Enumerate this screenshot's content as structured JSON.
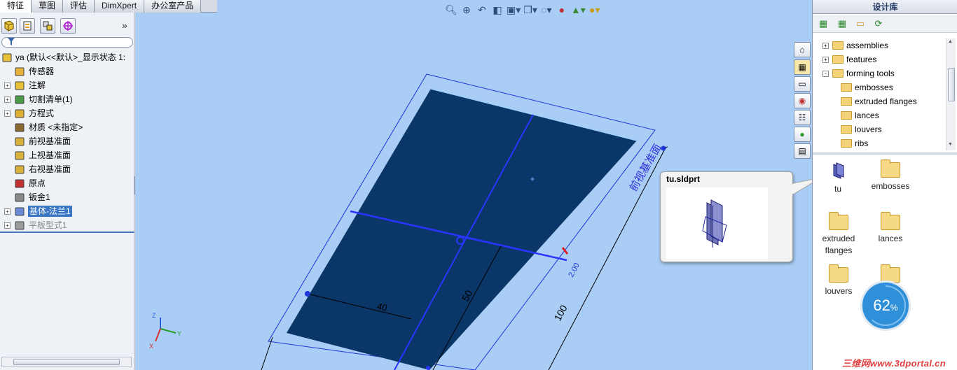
{
  "tabs": [
    "特征",
    "草图",
    "评估",
    "DimXpert",
    "办公室产品"
  ],
  "feature_manager": {
    "collapse_glyph": "»",
    "toolbar_icons": [
      "feature-manager-icon",
      "property-manager-icon",
      "configuration-manager-icon",
      "dimxpert-manager-icon"
    ],
    "tree": [
      {
        "label": "ya  (默认<<默认>_显示状态 1:",
        "icon": "part-icon",
        "expander": false,
        "root": true
      },
      {
        "label": "传感器",
        "icon": "sensor-icon",
        "expander": false
      },
      {
        "label": "注解",
        "icon": "annotation-icon",
        "expander": true
      },
      {
        "label": "切割清单(1)",
        "icon": "cutlist-icon",
        "expander": true
      },
      {
        "label": "方程式",
        "icon": "equation-icon",
        "expander": true
      },
      {
        "label": "材质 <未指定>",
        "icon": "material-icon",
        "expander": false
      },
      {
        "label": "前视基准面",
        "icon": "plane-icon",
        "expander": false
      },
      {
        "label": "上视基准面",
        "icon": "plane-icon",
        "expander": false
      },
      {
        "label": "右视基准面",
        "icon": "plane-icon",
        "expander": false
      },
      {
        "label": "原点",
        "icon": "origin-icon",
        "expander": false
      },
      {
        "label": "钣金1",
        "icon": "sheetmetal-icon",
        "expander": false
      },
      {
        "label": "基体-法兰1",
        "icon": "base-flange-icon",
        "expander": true,
        "selected": true
      },
      {
        "label": "平板型式1",
        "icon": "flat-pattern-icon",
        "expander": true,
        "grey": true
      }
    ]
  },
  "viewport": {
    "plane_label": "前视基准面",
    "dimensions": {
      "d1": "40",
      "d2": "50",
      "d3": "100",
      "d4": "2.00"
    },
    "triad": {
      "x": "X",
      "y": "Y",
      "z": "Z"
    },
    "heads_up_icons": [
      "zoom-to-fit-icon",
      "zoom-area-icon",
      "previous-view-icon",
      "section-view-icon",
      "view-orientation-icon",
      "display-style-icon",
      "hide-show-icon",
      "edit-appearance-icon",
      "apply-scene-icon",
      "view-settings-icon"
    ],
    "task_pane_tabs": [
      "home-icon",
      "design-library-icon",
      "file-explorer-icon",
      "search-icon",
      "view-palette-icon",
      "appearances-icon",
      "custom-properties-icon"
    ]
  },
  "popup": {
    "title": "tu.sldprt"
  },
  "design_library": {
    "title": "设计库",
    "toolbar_icons": [
      "add-to-library-icon",
      "add-file-location-icon",
      "create-folder-icon",
      "refresh-icon"
    ],
    "tree": [
      {
        "label": "assemblies",
        "level": 0,
        "expander": "+"
      },
      {
        "label": "features",
        "level": 0,
        "expander": "+"
      },
      {
        "label": "forming tools",
        "level": 0,
        "expander": "-"
      },
      {
        "label": "embosses",
        "level": 1
      },
      {
        "label": "extruded flanges",
        "level": 1
      },
      {
        "label": "lances",
        "level": 1
      },
      {
        "label": "louvers",
        "level": 1
      },
      {
        "label": "ribs",
        "level": 1
      }
    ],
    "items": [
      {
        "label": "tu",
        "kind": "part"
      },
      {
        "label": "embosses",
        "kind": "folder"
      },
      {
        "label": "extruded\nflanges",
        "kind": "folder"
      },
      {
        "label": "lances",
        "kind": "folder"
      },
      {
        "label": "louvers",
        "kind": "folder"
      },
      {
        "label": "",
        "kind": "folder"
      }
    ]
  },
  "progress": {
    "value": "62",
    "unit": "%"
  },
  "watermark": "三维网www.3dportal.cn",
  "colors": {
    "viewport_bg": "#a9cdf5",
    "part_face": "#0b3668",
    "sketch_blue": "#1f36d8",
    "selection": "#3b76c4"
  }
}
